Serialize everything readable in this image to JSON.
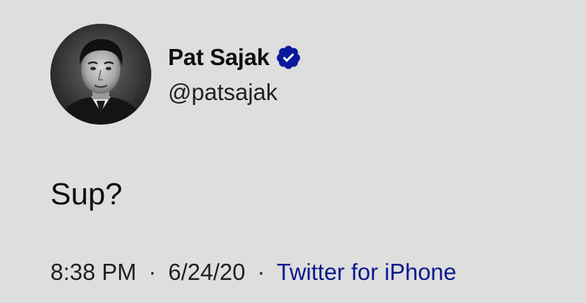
{
  "tweet": {
    "author": {
      "display_name": "Pat Sajak",
      "handle": "@patsajak",
      "verified": true,
      "avatar_icon": "profile-photo",
      "verified_icon": "verified-badge-icon"
    },
    "text": "Sup?",
    "meta": {
      "time": "8:38 PM",
      "separator": "·",
      "date": "6/24/20",
      "source": "Twitter for iPhone"
    }
  },
  "colors": {
    "background": "#dedede",
    "text": "#0f0f12",
    "link": "#0c1a8c",
    "verified": "#0a1a9a"
  }
}
